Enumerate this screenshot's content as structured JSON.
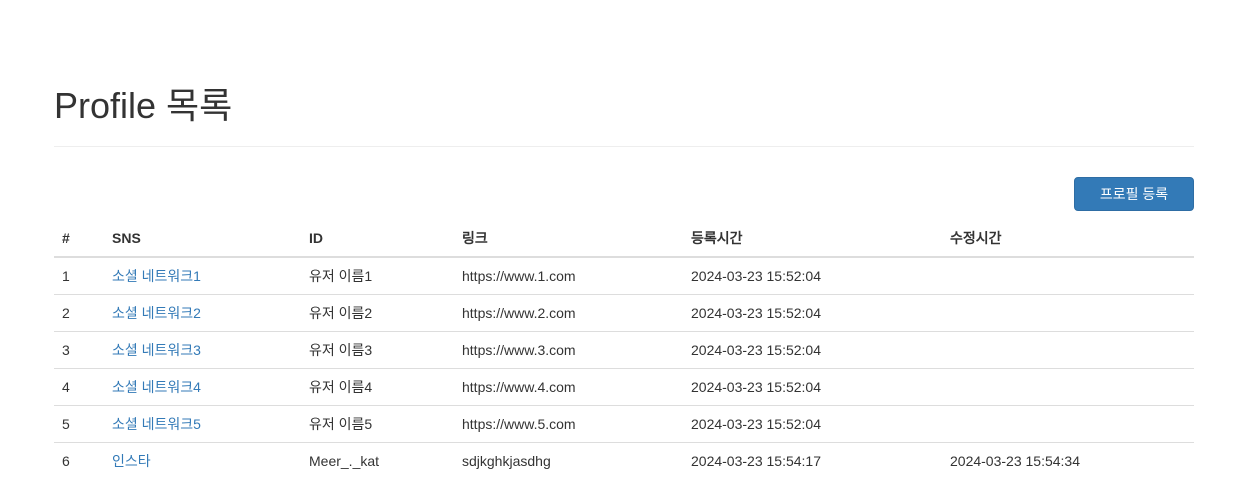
{
  "page": {
    "title": "Profile 목록"
  },
  "toolbar": {
    "add_label": "프로필 등록"
  },
  "table": {
    "columns": [
      "#",
      "SNS",
      "ID",
      "링크",
      "등록시간",
      "수정시간"
    ],
    "rows": [
      {
        "num": "1",
        "sns": "소셜 네트워크1",
        "id": "유저 이름1",
        "link": "https://www.1.com",
        "created": "2024-03-23 15:52:04",
        "updated": ""
      },
      {
        "num": "2",
        "sns": "소셜 네트워크2",
        "id": "유저 이름2",
        "link": "https://www.2.com",
        "created": "2024-03-23 15:52:04",
        "updated": ""
      },
      {
        "num": "3",
        "sns": "소셜 네트워크3",
        "id": "유저 이름3",
        "link": "https://www.3.com",
        "created": "2024-03-23 15:52:04",
        "updated": ""
      },
      {
        "num": "4",
        "sns": "소셜 네트워크4",
        "id": "유저 이름4",
        "link": "https://www.4.com",
        "created": "2024-03-23 15:52:04",
        "updated": ""
      },
      {
        "num": "5",
        "sns": "소셜 네트워크5",
        "id": "유저 이름5",
        "link": "https://www.5.com",
        "created": "2024-03-23 15:52:04",
        "updated": ""
      },
      {
        "num": "6",
        "sns": "인스타",
        "id": "Meer_._kat",
        "link": "sdjkghkjasdhg",
        "created": "2024-03-23 15:54:17",
        "updated": "2024-03-23 15:54:34"
      }
    ]
  },
  "colors": {
    "accent": "#337ab7",
    "text": "#333333",
    "border": "#dddddd"
  }
}
